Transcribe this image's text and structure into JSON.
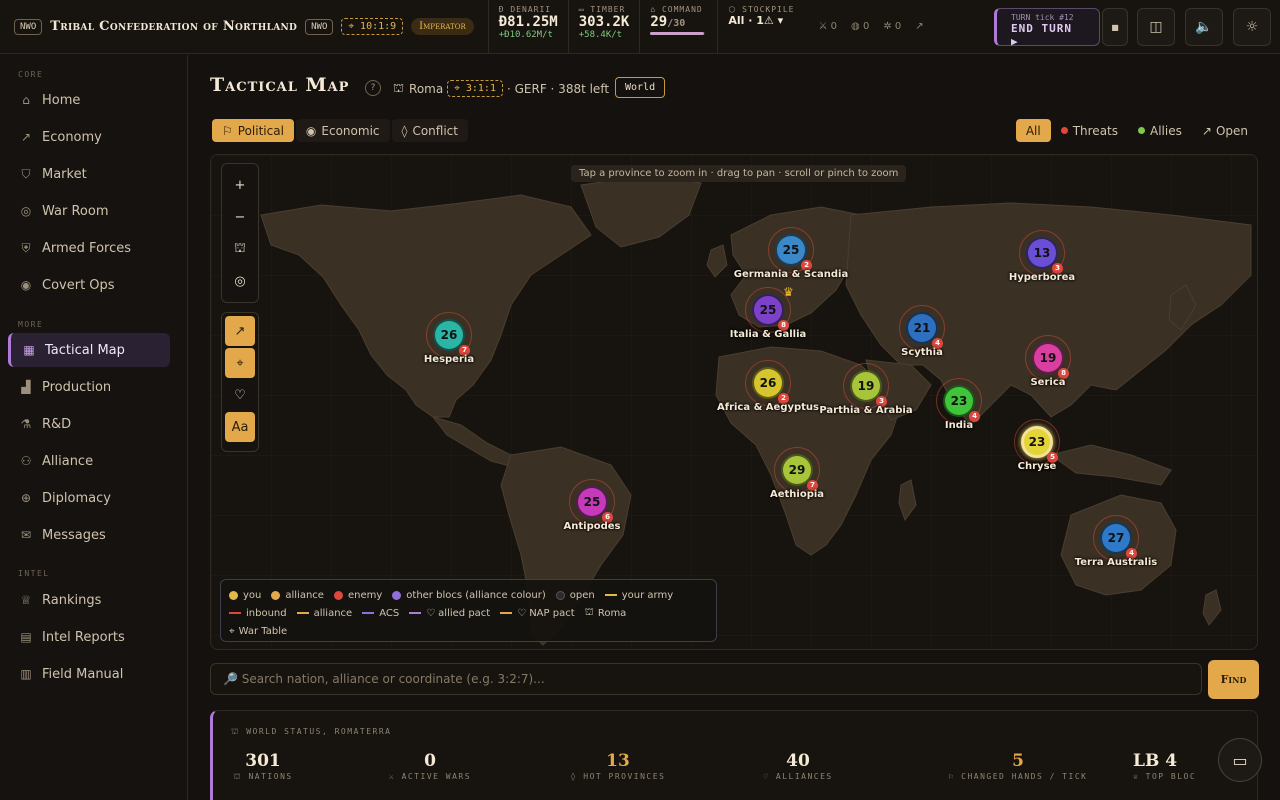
{
  "topbar": {
    "tag1": "NWO",
    "nation_name": "Tribal Confederation of Northland",
    "tag2": "NWO",
    "coord": "10:1:9",
    "rank": "Imperator",
    "resources": [
      {
        "label": "Ð DENARII",
        "value": "Ð81.25M",
        "sub": "+Ð10.62M/t"
      },
      {
        "label": "TIMBER",
        "value": "303.2K",
        "sub": "+58.4K/t"
      },
      {
        "label": "COMMAND",
        "value": "29",
        "max": "/30",
        "progress_pct": 97
      },
      {
        "label": "STOCKPILE",
        "value": "All · 1⚠ ▾"
      }
    ],
    "counters": [
      "0",
      "0",
      "0"
    ],
    "end_turn_label": "TURN tick #12",
    "end_turn_action": "END TURN ▶"
  },
  "sidebar": {
    "sections": [
      "CORE",
      "MORE",
      "INTEL"
    ],
    "core": [
      {
        "label": "Home",
        "icon": "home-icon"
      },
      {
        "label": "Economy",
        "icon": "trend-icon"
      },
      {
        "label": "Market",
        "icon": "bag-icon"
      },
      {
        "label": "War Room",
        "icon": "target-icon"
      },
      {
        "label": "Armed Forces",
        "icon": "shield-icon"
      },
      {
        "label": "Covert Ops",
        "icon": "eye-icon"
      }
    ],
    "more": [
      {
        "label": "Tactical Map",
        "icon": "map-icon",
        "active": true
      },
      {
        "label": "Production",
        "icon": "factory-icon"
      },
      {
        "label": "R&D",
        "icon": "flask-icon"
      },
      {
        "label": "Alliance",
        "icon": "users-icon"
      },
      {
        "label": "Diplomacy",
        "icon": "globe-icon"
      },
      {
        "label": "Messages",
        "icon": "mail-icon"
      }
    ],
    "intel": [
      {
        "label": "Rankings",
        "icon": "trophy-icon"
      },
      {
        "label": "Intel Reports",
        "icon": "report-icon"
      },
      {
        "label": "Field Manual",
        "icon": "book-icon"
      }
    ]
  },
  "header": {
    "title": "Tactical Map",
    "help": "?",
    "location": "Roma",
    "coord": "3:1:1",
    "location_tail": "· GERF · 388t left",
    "world_button": "World"
  },
  "tabs": [
    "Political",
    "Economic",
    "Conflict"
  ],
  "filters": [
    "All",
    "Threats",
    "Allies",
    "Open"
  ],
  "map": {
    "hint": "Tap a province to zoom in · drag to pan · scroll or pinch to zoom",
    "controls_text": "Aa",
    "provinces": [
      {
        "name": "Germania & Scandia",
        "value": "25",
        "badge": "2",
        "color": "#3a88c8"
      },
      {
        "name": "Hyperborea",
        "value": "13",
        "badge": "3",
        "color": "#6a4fd6"
      },
      {
        "name": "Italia & Gallia",
        "value": "25",
        "badge": "8",
        "color": "#7b42c8"
      },
      {
        "name": "Hesperia",
        "value": "26",
        "badge": "7",
        "color": "#2bb5a5"
      },
      {
        "name": "Scythia",
        "value": "21",
        "badge": "4",
        "color": "#2f6fc0"
      },
      {
        "name": "Serica",
        "value": "19",
        "badge": "8",
        "color": "#d93fa0"
      },
      {
        "name": "Africa & Aegyptus",
        "value": "26",
        "badge": "2",
        "color": "#d6c52e"
      },
      {
        "name": "Parthia & Arabia",
        "value": "19",
        "badge": "3",
        "color": "#a8c43a"
      },
      {
        "name": "India",
        "value": "23",
        "badge": "4",
        "color": "#3fc43a"
      },
      {
        "name": "Chryse",
        "value": "23",
        "badge": "5",
        "color": "#e3d43a"
      },
      {
        "name": "Aethiopia",
        "value": "29",
        "badge": "7",
        "color": "#a8c43a"
      },
      {
        "name": "Antipodes",
        "value": "25",
        "badge": "6",
        "color": "#c43ab8"
      },
      {
        "name": "Terra Australis",
        "value": "27",
        "badge": "4",
        "color": "#2f7ac8"
      }
    ],
    "legend": [
      {
        "label": "you",
        "color": "#e3b84a",
        "kind": "dot"
      },
      {
        "label": "alliance",
        "color": "#e3a84a",
        "kind": "dot"
      },
      {
        "label": "enemy",
        "color": "#e0473c",
        "kind": "dot"
      },
      {
        "label": "other blocs (alliance colour)",
        "color": "#9070d8",
        "kind": "dot"
      },
      {
        "label": "open",
        "color": "#2e2a26",
        "kind": "dot"
      },
      {
        "label": "your army",
        "color": "#e3b84a",
        "kind": "dash"
      },
      {
        "label": "inbound",
        "color": "#e0473c",
        "kind": "dash"
      },
      {
        "label": "alliance",
        "color": "#e3a84a",
        "kind": "dash"
      },
      {
        "label": "ACS",
        "color": "#9070d8",
        "kind": "dash"
      },
      {
        "label": "allied pact",
        "color": "#b07ad8",
        "kind": "line"
      },
      {
        "label": "NAP pact",
        "color": "#e3a84a",
        "kind": "dash"
      },
      {
        "label": "Roma",
        "color": "#cfc3ad",
        "kind": "icon"
      },
      {
        "label": "War Table",
        "color": "#cfc3ad",
        "kind": "icon"
      }
    ]
  },
  "search": {
    "placeholder": "🔎 Search nation, alliance or coordinate (e.g. 3:2:7)...",
    "button": "Find"
  },
  "status": {
    "title": "WORLD STATUS, ROMATERRA",
    "stats": [
      {
        "value": "301",
        "label": "NATIONS"
      },
      {
        "value": "0",
        "label": "ACTIVE WARS"
      },
      {
        "value": "13",
        "label": "HOT PROVINCES"
      },
      {
        "value": "40",
        "label": "ALLIANCES"
      },
      {
        "value": "5",
        "label": "CHANGED HANDS / TICK"
      },
      {
        "value": "LB 4",
        "label": "TOP BLOC"
      }
    ]
  }
}
